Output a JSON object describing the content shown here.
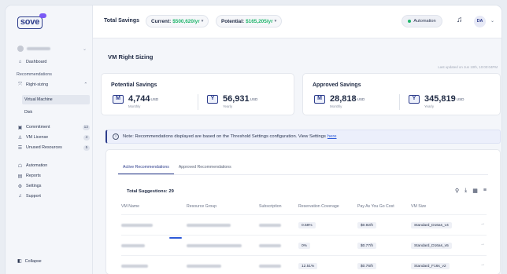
{
  "brand": {
    "logo_text": "sove",
    "accent": "#2d3d8c",
    "green": "#1fb56b"
  },
  "sidebar": {
    "dashboard": "Dashboard",
    "recommendations_label": "Recommendations",
    "right_sizing": "Right-sizing",
    "sub_items": [
      "Virtual Machine",
      "Disk"
    ],
    "items": [
      {
        "label": "Commitment",
        "count": "12"
      },
      {
        "label": "VM License",
        "count": "4"
      },
      {
        "label": "Unused Resources",
        "count": "5"
      }
    ],
    "bottom_items": [
      "Automation",
      "Reports",
      "Settings",
      "Support"
    ],
    "collapse": "Collapse"
  },
  "topbar": {
    "total_savings_label": "Total Savings",
    "current_label": "Current:",
    "current_value": "$500,620/yr",
    "potential_label": "Potential:",
    "potential_value": "$165,205/yr",
    "automation": "Automation",
    "user_initials": "DA"
  },
  "page": {
    "title": "VM Right Sizing",
    "last_updated": "Last updated on Jun 10th, 10:00:04PM"
  },
  "potential_savings": {
    "title": "Potential Savings",
    "monthly_value": "4,744",
    "monthly_unit": "USD",
    "monthly_label": "Monthly",
    "yearly_value": "56,931",
    "yearly_unit": "USD",
    "yearly_label": "Yearly"
  },
  "approved_savings": {
    "title": "Approved Savings",
    "monthly_value": "28,818",
    "monthly_unit": "USD",
    "monthly_label": "Monthly",
    "yearly_value": "345,819",
    "yearly_unit": "USD",
    "yearly_label": "Yearly"
  },
  "notice": {
    "text": "Note: Recommendations displayed are based on the Threshold Settings configuration. View Settings",
    "link": "here"
  },
  "panel": {
    "tabs": [
      "Active Recommendations",
      "Approved Recommendations"
    ],
    "total_suggestions": "Total Suggestions: 29",
    "columns": [
      "VM Name",
      "Resource Group",
      "Subscription",
      "Reservation Coverage",
      "Pay As You Go Cost",
      "VM Size"
    ],
    "rows": [
      {
        "coverage": "0.58%",
        "cost": "$0.92/h",
        "size": "Standard_D16as_v4"
      },
      {
        "coverage": "0%",
        "cost": "$0.77/h",
        "size": "Standard_D16as_v5"
      },
      {
        "coverage": "12.51%",
        "cost": "$0.76/h",
        "size": "Standard_F16s_v2"
      }
    ]
  }
}
